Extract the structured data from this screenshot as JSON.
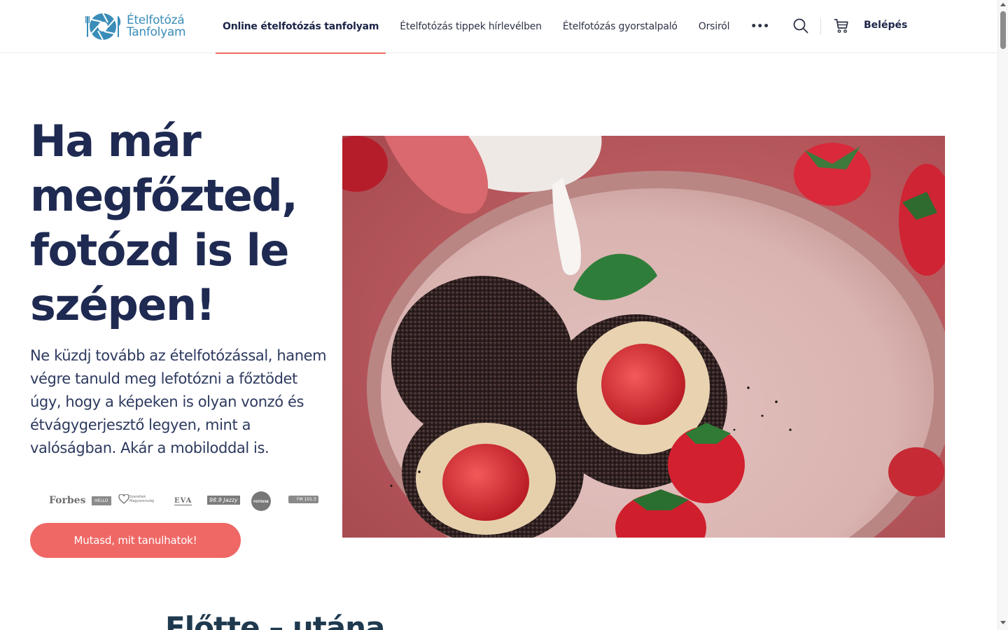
{
  "header": {
    "logo": {
      "line1": "Ételfotózá",
      "line2": "Tanfolyam"
    },
    "nav": [
      {
        "label": "Online ételfotózás tanfolyam",
        "active": true
      },
      {
        "label": "Ételfotózás tippek hírlevélben",
        "active": false
      },
      {
        "label": "Ételfotózás gyorstalpaló",
        "active": false
      },
      {
        "label": "Orsiról",
        "active": false
      }
    ],
    "more_label": "•••",
    "search_icon": "search-icon",
    "cart_icon": "cart-icon",
    "login_label": "Belépés"
  },
  "hero": {
    "title": "Ha már megfőzted, fotózd is le szépen!",
    "text": "Ne küzdj tovább az ételfotózással, hanem végre tanuld meg lefotózni a főztödet úgy, hogy a képeken is olyan vonzó és étvágygerjesztő legyen, mint a valóságban. Akár a mobiloddal is.",
    "press_logos": [
      "Forbes",
      "HELLO",
      "Szeretlek Magyarország",
      "EVA",
      "98.9 Jazzy",
      "FOTÓSOK",
      "FM 101.3"
    ],
    "cta_label": "Mutasd, mit tanulhatok!",
    "image_subject": "poppy-seed strawberry dumplings with cream pour"
  },
  "next_section": {
    "title": "Előtte – utána"
  },
  "colors": {
    "accent": "#ef6865",
    "heading": "#1f2a52",
    "logo_blue": "#3a8db8"
  }
}
